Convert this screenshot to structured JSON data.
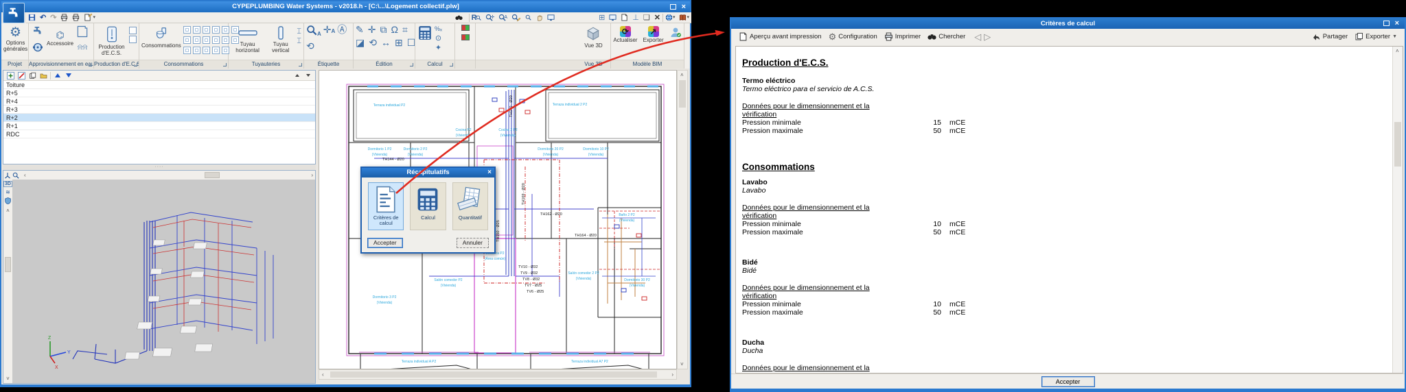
{
  "left_window": {
    "title": "CYPEPLUMBING Water Systems - v2018.h - [C:\\...\\Logement collectif.plw]",
    "ribbon": {
      "groups": [
        {
          "label": "Projet"
        },
        {
          "label": "Approvisionnement en eau"
        },
        {
          "label": "Production d'E.C.S."
        },
        {
          "label": "Consommations"
        },
        {
          "label": "Tuyauteries"
        },
        {
          "label": "Étiquette"
        },
        {
          "label": "Édition"
        },
        {
          "label": "Calcul"
        },
        {
          "label": ""
        },
        {
          "label": "Vue 3D"
        },
        {
          "label": "Modèle BIM"
        }
      ],
      "buttons": {
        "options": "Options générales",
        "accessoire": "Accessoire",
        "prod_ecs": "Production d'E.C.S.",
        "consommations": "Consommations",
        "tuyau_h": "Tuyau horizontal",
        "tuyau_v": "Tuyau vertical",
        "vue3d": "Vue 3D",
        "actualiser": "Actualiser",
        "exporter": "Exporter"
      }
    },
    "floors": {
      "items": [
        "Toiture",
        "R+5",
        "R+4",
        "R+3",
        "R+2",
        "R+1",
        "RDC"
      ],
      "selected": "R+2"
    },
    "dialog": {
      "title": "Récapitulatifs",
      "option1": "Critères de calcul",
      "option2": "Calcul",
      "option3": "Quantitatif",
      "accept": "Accepter",
      "cancel": "Annuler"
    },
    "plan": {
      "rooms": [
        {
          "name": "Terraza individual P2",
          "sub": ""
        },
        {
          "name": "Terraza individual 2 P2",
          "sub": ""
        },
        {
          "name": "Dormitorio 1 P2",
          "sub": "(Vivienda)"
        },
        {
          "name": "Dormitorio 2 P2",
          "sub": "(Vivienda)"
        },
        {
          "name": "Cocina P2",
          "sub": "(Vivienda)"
        },
        {
          "name": "Cocina 2 P2",
          "sub": "(Vivienda)"
        },
        {
          "name": "Dormitorio 20 P2",
          "sub": "(Vivienda)"
        },
        {
          "name": "Dormitorio 10 P2",
          "sub": "(Vivienda)"
        },
        {
          "name": "Dormitorio 3 P2",
          "sub": "(Vivienda)"
        },
        {
          "name": "Salón comedor P2",
          "sub": "(Vivienda)"
        },
        {
          "name": "Escalera P2",
          "sub": "(Área común)"
        },
        {
          "name": "Salón comedor 2 P2",
          "sub": "(Vivienda)"
        },
        {
          "name": "Dormitorio 30 P2",
          "sub": "(Vivienda)"
        },
        {
          "name": "Baño 2 P2",
          "sub": "(Vivienda)"
        },
        {
          "name": "Terraza individual A P2",
          "sub": ""
        },
        {
          "name": "Terraza individual A7 P2",
          "sub": ""
        }
      ],
      "pipes": [
        "TH144 - Ø20",
        "TH169 - Ø20",
        "TH101 - Ø25",
        "TH150 - Ø25",
        "TH162 - Ø20",
        "TH164 - Ø20",
        "TV10 - Ø32",
        "TV9 - Ø32",
        "TV8 - Ø32",
        "TV7 - Ø25",
        "TV6 - Ø25",
        "TH140 - Ø20"
      ]
    }
  },
  "right_window": {
    "title": "Critères de calcul",
    "toolbar": {
      "preview": "Aperçu avant impression",
      "config": "Configuration",
      "print": "Imprimer",
      "search": "Chercher",
      "share": "Partager",
      "export": "Exporter"
    },
    "doc": {
      "h1": "Production d'E.C.S.",
      "h2": "Consommations",
      "f1_name": "Termo eléctrico",
      "f1_desc": "Termo eléctrico para el servicio de A.C.S.",
      "f2_name": "Lavabo",
      "f2_desc": "Lavabo",
      "f3_name": "Bidé",
      "f3_desc": "Bidé",
      "f4_name": "Ducha",
      "f4_desc": "Ducha",
      "data_title_l1": "Données pour le dimensionnement et la",
      "data_title_l2": "vérification",
      "p_min": "Pression minimale",
      "p_max": "Pression maximale",
      "unit": "mCE",
      "f1_min": "15",
      "f1_max": "50",
      "f2_min": "10",
      "f2_max": "50",
      "f3_min": "10",
      "f3_max": "50"
    },
    "accept": "Accepter"
  }
}
